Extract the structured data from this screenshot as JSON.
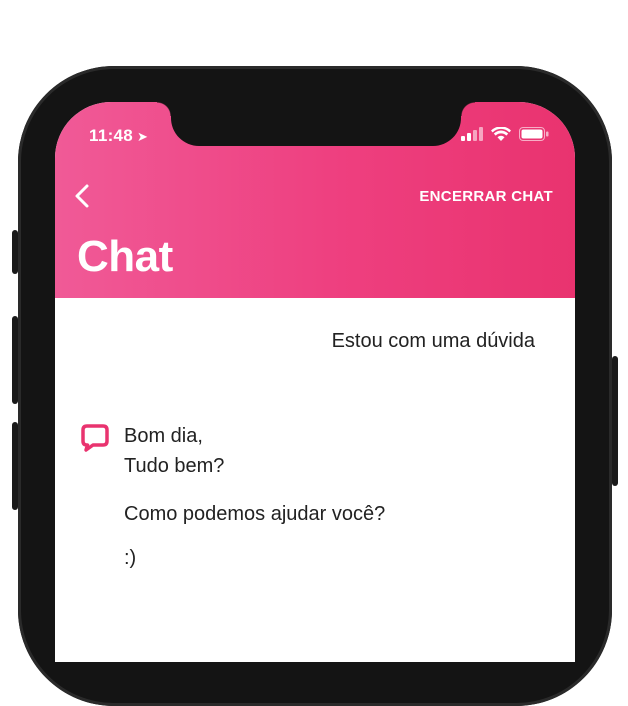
{
  "status_bar": {
    "time": "11:48",
    "location_icon": "location-arrow-icon",
    "signal_icon": "cellular-signal-icon",
    "wifi_icon": "wifi-icon",
    "battery_icon": "battery-icon"
  },
  "header": {
    "back_icon": "chevron-left-icon",
    "end_chat_label": "ENCERRAR CHAT",
    "title": "Chat",
    "gradient_colors": [
      "#f05a97",
      "#e9336f"
    ]
  },
  "messages": {
    "user": {
      "text": "Estou com uma dúvida"
    },
    "bot": {
      "icon": "chat-bubble-icon",
      "accent_color": "#e9336f",
      "lines": [
        "Bom dia,",
        "Tudo bem?",
        "Como podemos ajudar você?",
        ":)"
      ]
    }
  }
}
